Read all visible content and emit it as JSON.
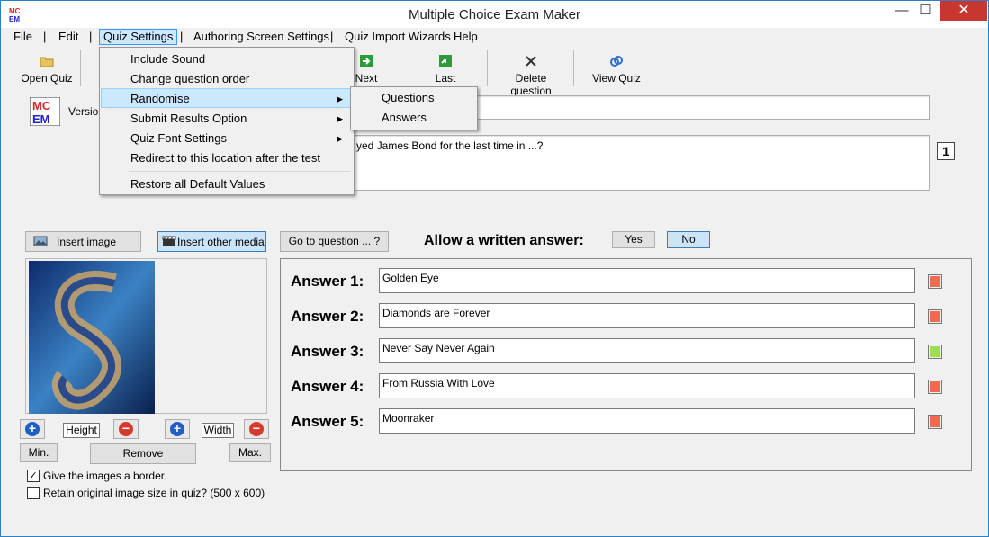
{
  "window": {
    "title": "Multiple Choice Exam Maker",
    "icon_text": "MC EM",
    "controls": {
      "minimize": "—",
      "maximize": "☐",
      "close": "✕"
    }
  },
  "menubar": {
    "file": "File",
    "edit": "Edit",
    "quiz_settings": "Quiz Settings",
    "authoring": "Authoring Screen Settings",
    "import": "Quiz Import Wizards",
    "help": "Help",
    "separator": "|"
  },
  "toolbar": {
    "open_quiz": "Open Quiz",
    "next": "Next",
    "last": "Last",
    "delete_question": "Delete question",
    "view_quiz": "View Quiz"
  },
  "version_label": "Version",
  "question": {
    "text": "yed James Bond for the last time in ...?",
    "number": "1"
  },
  "quiz_settings_menu": {
    "items": [
      {
        "label": "Include Sound",
        "submenu": false
      },
      {
        "label": "Change question order",
        "submenu": false
      },
      {
        "label": "Randomise",
        "submenu": true
      },
      {
        "label": "Submit Results Option",
        "submenu": true
      },
      {
        "label": "Quiz Font Settings",
        "submenu": true
      },
      {
        "label": "Redirect to this location after the test",
        "submenu": false
      },
      {
        "label": "Restore all Default Values",
        "submenu": false
      }
    ],
    "arrow": "▶"
  },
  "randomise_submenu": {
    "questions": "Questions",
    "answers": "Answers"
  },
  "media": {
    "insert_image": "Insert image",
    "insert_other_media": "Insert other media",
    "goto_question": "Go to question ... ?",
    "height": "Height",
    "width": "Width",
    "min": "Min.",
    "remove": "Remove",
    "max": "Max.",
    "plus": "+",
    "minus": "−"
  },
  "written_answer": {
    "label": "Allow a written answer:",
    "yes": "Yes",
    "no": "No",
    "selected": "No"
  },
  "answers": [
    {
      "label": "Answer 1:",
      "value": "Golden Eye",
      "correct": false
    },
    {
      "label": "Answer 2:",
      "value": "Diamonds are Forever",
      "correct": false
    },
    {
      "label": "Answer 3:",
      "value": "Never Say Never Again",
      "correct": true
    },
    {
      "label": "Answer 4:",
      "value": "From Russia With Love",
      "correct": false
    },
    {
      "label": "Answer 5:",
      "value": "Moonraker",
      "correct": false
    }
  ],
  "options": {
    "border": {
      "label": "Give the images a border.",
      "checked": true,
      "mark": "✓"
    },
    "retain": {
      "label": "Retain original image size in quiz? (500 x 600)",
      "checked": false
    }
  },
  "colors": {
    "wrong": "#f06a50",
    "correct": "#9ee04c",
    "highlight": "#cce8ff",
    "close": "#c7372f"
  }
}
